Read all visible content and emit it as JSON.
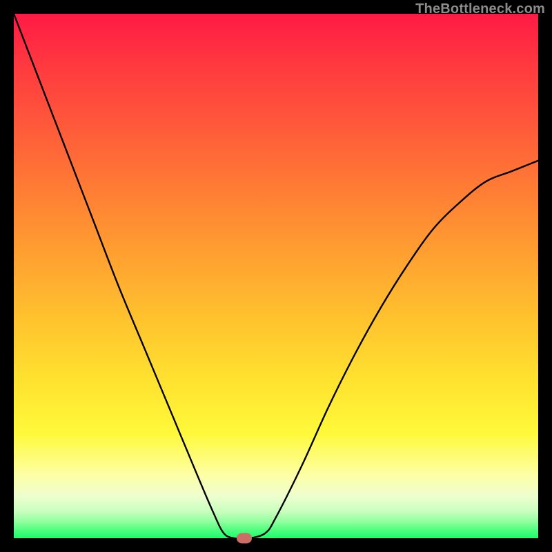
{
  "watermark": "TheBottleneck.com",
  "chart_data": {
    "type": "line",
    "title": "",
    "xlabel": "",
    "ylabel": "",
    "xlim": [
      0,
      100
    ],
    "ylim": [
      0,
      100
    ],
    "series": [
      {
        "name": "bottleneck-curve",
        "x": [
          0,
          5,
          10,
          15,
          20,
          25,
          30,
          35,
          38,
          40,
          42,
          45,
          48,
          50,
          55,
          60,
          65,
          70,
          75,
          80,
          85,
          90,
          95,
          100
        ],
        "y": [
          100,
          87,
          74,
          61,
          48,
          36,
          24,
          12,
          5,
          1,
          0,
          0,
          1,
          4,
          14,
          25,
          35,
          44,
          52,
          59,
          64,
          68,
          70,
          72
        ]
      }
    ],
    "marker": {
      "x": 44,
      "y": 0
    },
    "gradient_stops": [
      {
        "pos": 0,
        "color": "#ff1a45"
      },
      {
        "pos": 50,
        "color": "#ffb030"
      },
      {
        "pos": 80,
        "color": "#fff93a"
      },
      {
        "pos": 100,
        "color": "#1aff6a"
      }
    ]
  }
}
